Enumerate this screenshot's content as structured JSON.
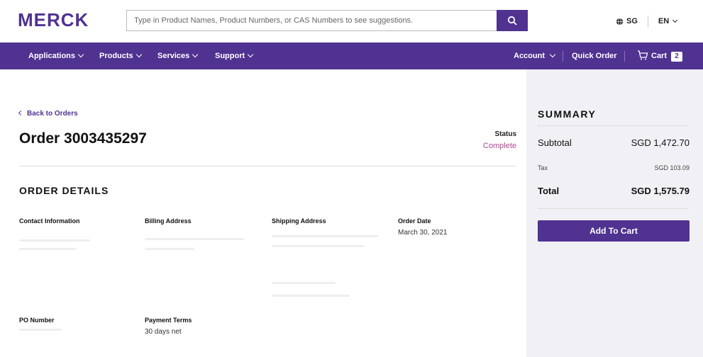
{
  "header": {
    "logo_text": "MERCK",
    "search_placeholder": "Type in Product Names, Product Numbers, or CAS Numbers to see suggestions.",
    "region": "SG",
    "language": "EN"
  },
  "nav": {
    "items": [
      "Applications",
      "Products",
      "Services",
      "Support"
    ],
    "account": "Account",
    "quick_order": "Quick Order",
    "cart": "Cart",
    "cart_count": "2"
  },
  "order": {
    "back_link": "Back to Orders",
    "title": "Order 3003435297",
    "status_label": "Status",
    "status_value": "Complete",
    "section_title": "ORDER DETAILS",
    "contact_label": "Contact Information",
    "billing_label": "Billing Address",
    "shipping_label": "Shipping Address",
    "date_label": "Order Date",
    "date_value": "March 30, 2021",
    "po_label": "PO Number",
    "payment_label": "Payment Terms",
    "payment_value": "30 days net"
  },
  "summary": {
    "title": "SUMMARY",
    "subtotal_label": "Subtotal",
    "subtotal_value": "SGD 1,472.70",
    "tax_label": "Tax",
    "tax_value": "SGD 103.09",
    "total_label": "Total",
    "total_value": "SGD 1,575.79",
    "button": "Add To Cart"
  },
  "colors": {
    "brand": "#503291",
    "status": "#b0488f",
    "summary_bg": "#f1f0f4"
  },
  "icons": [
    "search-icon",
    "globe-icon",
    "chevron-down-icon",
    "cart-icon",
    "chevron-left-icon"
  ]
}
